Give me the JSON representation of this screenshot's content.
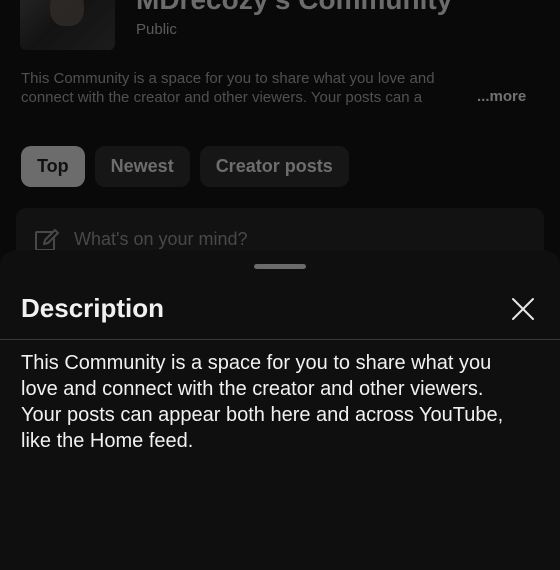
{
  "community": {
    "title": "MDrecozy's Community",
    "privacy": "Public",
    "description_preview_line1": "This Community is a space for you to share what you love and",
    "description_preview_line2": "connect with the creator and other viewers. Your posts can a",
    "more_label": "...more"
  },
  "filters": [
    {
      "label": "Top",
      "active": true
    },
    {
      "label": "Newest",
      "active": false
    },
    {
      "label": "Creator posts",
      "active": false
    }
  ],
  "composer": {
    "placeholder": "What's on your mind?",
    "icon": "edit-pencil-icon"
  },
  "sheet": {
    "title": "Description",
    "close_icon": "close-icon",
    "body_lines": [
      "This Community is a space for you to share what you",
      "love and connect with the creator and other viewers.",
      "Your posts can appear both here and across YouTube,",
      "like the Home feed."
    ]
  },
  "colors": {
    "background": "#0f0f0f",
    "text_primary": "#f1f1f1",
    "chip_active": "#a7a7a7",
    "chip_inactive": "#222222"
  }
}
